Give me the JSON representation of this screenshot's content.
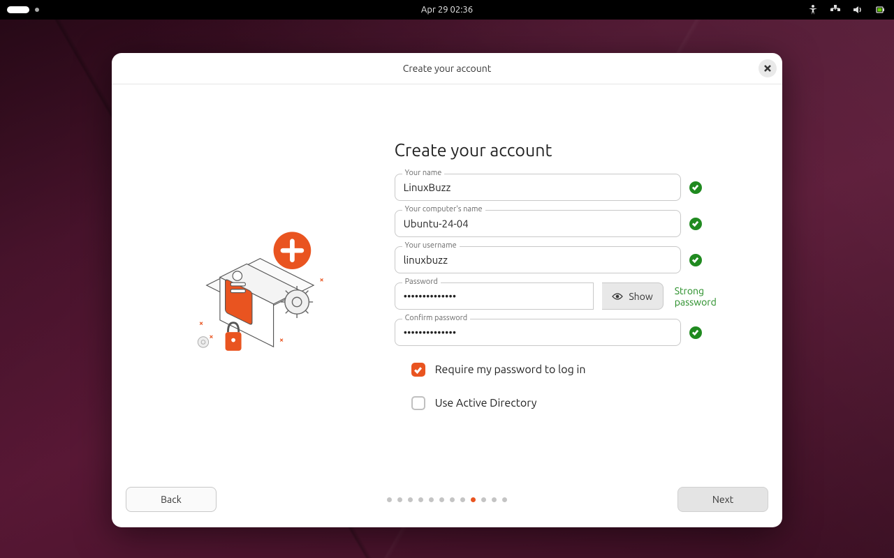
{
  "topbar": {
    "datetime": "Apr 29  02:36"
  },
  "dialog": {
    "title": "Create your account",
    "heading": "Create your account"
  },
  "fields": {
    "name": {
      "label": "Your name",
      "value": "LinuxBuzz"
    },
    "computer": {
      "label": "Your computer's name",
      "value": "Ubuntu-24-04"
    },
    "username": {
      "label": "Your username",
      "value": "linuxbuzz"
    },
    "password": {
      "label": "Password",
      "value": "••••••••••••••",
      "show": "Show",
      "strength": "Strong password"
    },
    "confirm": {
      "label": "Confirm password",
      "value": "••••••••••••••"
    }
  },
  "checkboxes": {
    "require_password": {
      "label": "Require my password to log in",
      "checked": true
    },
    "active_directory": {
      "label": "Use Active Directory",
      "checked": false
    }
  },
  "footer": {
    "back": "Back",
    "next": "Next"
  },
  "progress": {
    "total": 12,
    "active_index": 8
  }
}
